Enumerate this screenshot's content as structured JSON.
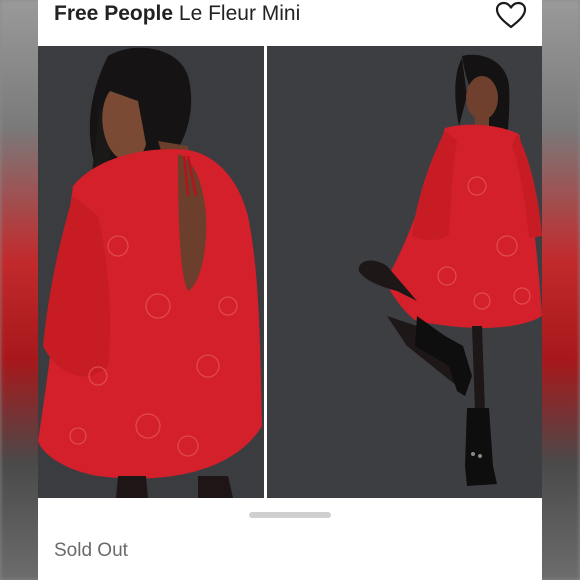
{
  "listing": {
    "brand": "Free People",
    "name": "Le Fleur Mini",
    "status": "Sold Out"
  },
  "icons": {
    "favorite": "heart-outline-icon"
  },
  "colors": {
    "dress_red": "#d3202a",
    "photo_background": "#3a3b3f"
  }
}
